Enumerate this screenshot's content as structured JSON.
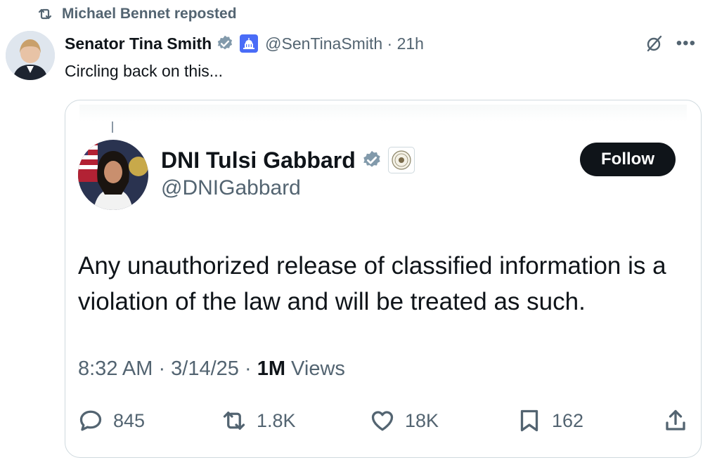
{
  "repost": {
    "label": "Michael Bennet reposted",
    "icon": "repost-icon"
  },
  "tweet": {
    "author_name": "Senator Tina Smith",
    "handle_time": "@SenTinaSmith · 21h",
    "text": "Circling back on this...",
    "icons": [
      "verified-badge-icon",
      "government-capitol-badge-icon",
      "grok-icon",
      "more-icon"
    ]
  },
  "quoted": {
    "author_name": "DNI Tulsi Gabbard",
    "handle": "@DNIGabbard",
    "follow_label": "Follow",
    "text": "Any unauthorized release of classified information is a violation of the law and will be treated as such.",
    "meta_time": "8:32 AM · 3/14/25 · ",
    "meta_views_count": "1M",
    "meta_views_label": " Views",
    "actions": {
      "replies": "845",
      "reposts": "1.8K",
      "likes": "18K",
      "bookmarks": "162"
    }
  },
  "colors": {
    "text_primary": "#0f1419",
    "text_secondary": "#536471",
    "border": "#cfd9de",
    "verified": "#829aab",
    "follow_bg": "#0f1419"
  }
}
